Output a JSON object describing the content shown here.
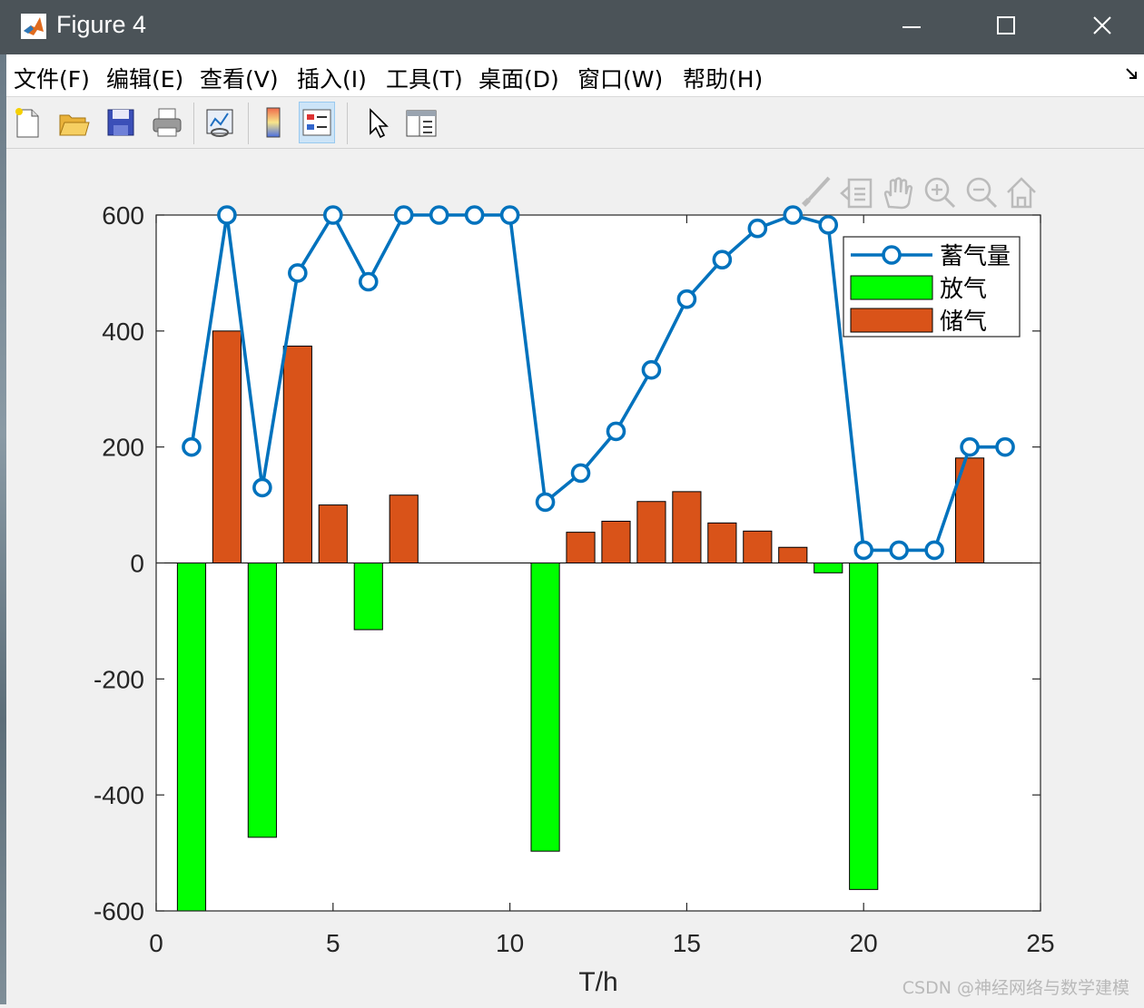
{
  "window": {
    "title": "Figure 4"
  },
  "menu": [
    "文件(F)",
    "编辑(E)",
    "查看(V)",
    "插入(I)",
    "工具(T)",
    "桌面(D)",
    "窗口(W)",
    "帮助(H)"
  ],
  "toolbar": [
    "new-figure-icon",
    "open-file-icon",
    "save-icon",
    "print-icon",
    "link-plot-icon",
    "colorbar-icon",
    "legend-icon",
    "edit-plot-icon",
    "property-inspector-icon"
  ],
  "axes_toolbar": [
    "brush-icon",
    "data-tips-icon",
    "pan-icon",
    "zoom-in-icon",
    "zoom-out-icon",
    "home-icon"
  ],
  "watermark": "CSDN @神经网络与数学建模",
  "chart_data": {
    "type": "bar",
    "xlabel": "T/h",
    "ylabel": "",
    "title": "",
    "xlim": [
      0,
      25
    ],
    "ylim": [
      -600,
      600
    ],
    "xticks": [
      0,
      5,
      10,
      15,
      20,
      25
    ],
    "yticks": [
      -600,
      -400,
      -200,
      0,
      200,
      400,
      600
    ],
    "grid": false,
    "legend_position": "top-right",
    "x": [
      1,
      2,
      3,
      4,
      5,
      6,
      7,
      8,
      9,
      10,
      11,
      12,
      13,
      14,
      15,
      16,
      17,
      18,
      19,
      20,
      21,
      22,
      23,
      24
    ],
    "series": [
      {
        "name": "蓄气量",
        "kind": "line",
        "marker": "circle",
        "color": "#0072bd",
        "values": [
          200,
          600,
          130,
          500,
          600,
          485,
          600,
          600,
          600,
          600,
          105,
          155,
          227,
          333,
          455,
          523,
          577,
          600,
          583,
          22,
          22,
          22,
          200,
          200
        ]
      },
      {
        "name": "放气",
        "kind": "bar",
        "color": "#00ff00",
        "values": [
          -600,
          0,
          -473,
          0,
          0,
          -115,
          0,
          0,
          0,
          0,
          -497,
          0,
          0,
          0,
          0,
          0,
          0,
          0,
          -17,
          -563,
          0,
          0,
          0,
          0
        ]
      },
      {
        "name": "储气",
        "kind": "bar",
        "color": "#d95319",
        "values": [
          0,
          400,
          0,
          374,
          100,
          0,
          117,
          0,
          0,
          0,
          0,
          53,
          72,
          106,
          123,
          69,
          55,
          27,
          0,
          0,
          0,
          0,
          181,
          0
        ]
      }
    ]
  }
}
